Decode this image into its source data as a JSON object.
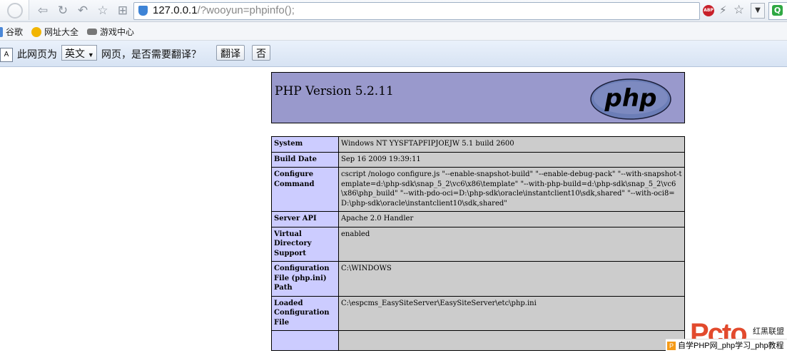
{
  "browser": {
    "address": {
      "host": "127.0.0.1",
      "path": "/?wooyun=phpinfo();"
    },
    "icons": [
      "back-icon",
      "forward-icon",
      "undo-icon",
      "star-icon",
      "grid-icon"
    ]
  },
  "bookmarks": [
    {
      "label": "谷歌",
      "icon": "google-icon",
      "color": "#4a87d8"
    },
    {
      "label": "网址大全",
      "icon": "navigation-icon",
      "color": "#f2b500"
    },
    {
      "label": "游戏中心",
      "icon": "gamepad-icon",
      "color": "#777777"
    }
  ],
  "translate_bar": {
    "prefix": "此网页为",
    "language": "英文",
    "suffix": "网页，是否需要翻译？",
    "translate_label": "翻译",
    "no_label": "否"
  },
  "phpinfo": {
    "title": "PHP Version 5.2.11",
    "logo_text": "php",
    "rows": [
      {
        "key": "System",
        "value": "Windows NT YYSFTAPFIPJOEJW 5.1 build 2600"
      },
      {
        "key": "Build Date",
        "value": "Sep 16 2009 19:39:11"
      },
      {
        "key": "Configure Command",
        "value": "cscript /nologo configure.js \"--enable-snapshot-build\" \"--enable-debug-pack\" \"--with-snapshot-template=d:\\php-sdk\\snap_5_2\\vc6\\x86\\template\" \"--with-php-build=d:\\php-sdk\\snap_5_2\\vc6\\x86\\php_build\" \"--with-pdo-oci=D:\\php-sdk\\oracle\\instantclient10\\sdk,shared\" \"--with-oci8=D:\\php-sdk\\oracle\\instantclient10\\sdk,shared\""
      },
      {
        "key": "Server API",
        "value": "Apache 2.0 Handler"
      },
      {
        "key": "Virtual Directory Support",
        "value": "enabled"
      },
      {
        "key": "Configuration File (php.ini) Path",
        "value": "C:\\WINDOWS"
      },
      {
        "key": "Loaded Configuration File",
        "value": "C:\\espcms_EasySiteServer\\EasySiteServer\\etc\\php.ini"
      },
      {
        "key": "",
        "value": ""
      }
    ]
  },
  "watermark": {
    "logo": "Pcto",
    "side_text": "红黑联盟",
    "bottom_text": "自学PHP网_php学习_php教程"
  },
  "colors": {
    "php_header": "#9999cc",
    "key_cell": "#ccccff",
    "value_cell": "#cccccc"
  }
}
